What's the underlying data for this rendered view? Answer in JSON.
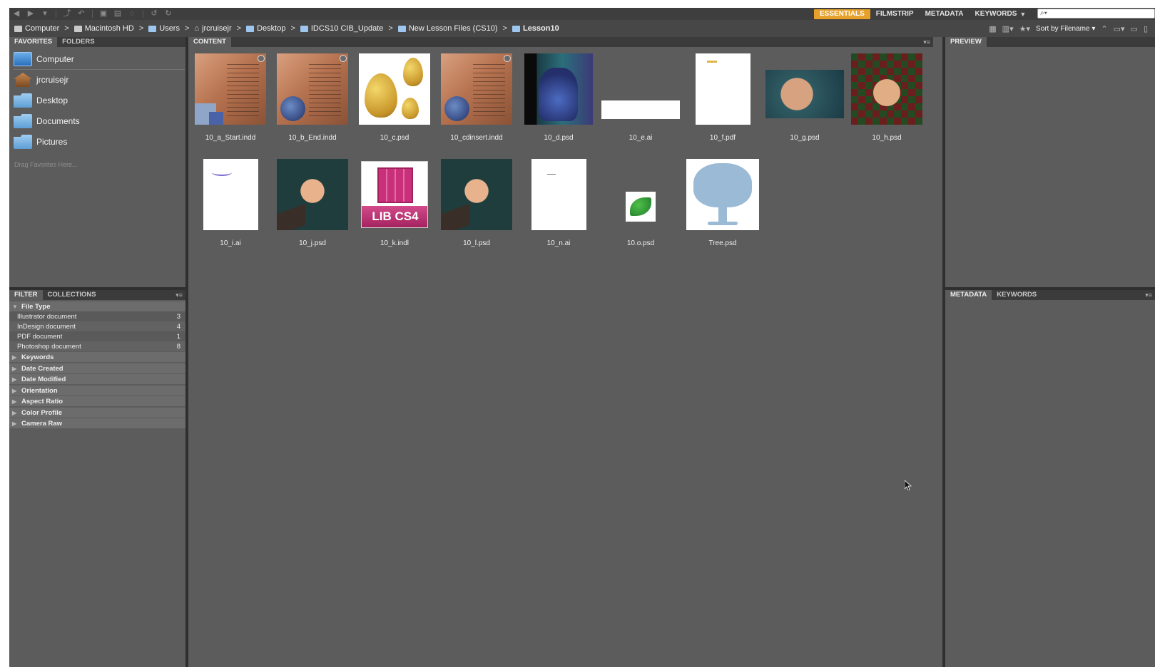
{
  "toolbar": {
    "workspaces": [
      {
        "label": "ESSENTIALS",
        "active": true
      },
      {
        "label": "FILMSTRIP",
        "active": false
      },
      {
        "label": "METADATA",
        "active": false
      },
      {
        "label": "KEYWORDS",
        "active": false
      }
    ],
    "search_icon": "search-icon"
  },
  "path": {
    "crumbs": [
      "Computer",
      "Macintosh HD",
      "Users",
      "jrcruisejr",
      "Desktop",
      "IDCS10 CIB_Update",
      "New Lesson Files (CS10)",
      "Lesson10"
    ],
    "sort_label": "Sort by Filename"
  },
  "favorites": {
    "tabs": [
      "FAVORITES",
      "FOLDERS"
    ],
    "items": [
      "Computer",
      "jrcruisejr",
      "Desktop",
      "Documents",
      "Pictures"
    ],
    "hint": "Drag Favorites Here..."
  },
  "filter": {
    "tabs": [
      "FILTER",
      "COLLECTIONS"
    ],
    "file_type_label": "File Type",
    "file_types": [
      {
        "label": "Illustrator document",
        "count": "3"
      },
      {
        "label": "InDesign document",
        "count": "4"
      },
      {
        "label": "PDF document",
        "count": "1"
      },
      {
        "label": "Photoshop document",
        "count": "8"
      }
    ],
    "categories": [
      "Keywords",
      "Date Created",
      "Date Modified",
      "Orientation",
      "Aspect Ratio",
      "Color Profile",
      "Camera Raw"
    ]
  },
  "content": {
    "tab": "CONTENT",
    "files": [
      {
        "name": "10_a_Start.indd"
      },
      {
        "name": "10_b_End.indd"
      },
      {
        "name": "10_c.psd"
      },
      {
        "name": "10_cdinsert.indd"
      },
      {
        "name": "10_d.psd"
      },
      {
        "name": "10_e.ai"
      },
      {
        "name": "10_f.pdf"
      },
      {
        "name": "10_g.psd"
      },
      {
        "name": "10_h.psd"
      },
      {
        "name": "10_i.ai"
      },
      {
        "name": "10_j.psd"
      },
      {
        "name": "10_k.indl",
        "badge_text": "LIB CS4"
      },
      {
        "name": "10_l.psd"
      },
      {
        "name": "10_n.ai"
      },
      {
        "name": "10.o.psd"
      },
      {
        "name": "Tree.psd"
      }
    ]
  },
  "preview": {
    "tab": "PREVIEW"
  },
  "metadata": {
    "tabs": [
      "METADATA",
      "KEYWORDS"
    ]
  }
}
